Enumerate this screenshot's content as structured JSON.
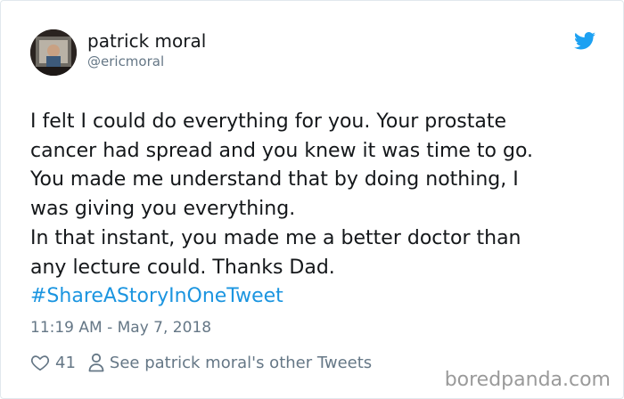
{
  "author": {
    "display_name": "patrick moral",
    "handle": "@ericmoral"
  },
  "tweet": {
    "lines": [
      "I felt I could do everything for you. Your prostate",
      "cancer had spread and you knew it was time to go.",
      "You made me understand that by doing nothing, I",
      "was giving you everything.",
      "In that instant, you made me a better doctor than",
      "any lecture could. Thanks Dad."
    ],
    "hashtag": "#ShareAStoryInOneTweet",
    "timestamp": "11:19 AM - May 7, 2018"
  },
  "actions": {
    "like_count": "41",
    "other_tweets_label": "See patrick moral's other Tweets"
  },
  "watermark": "boredpanda.com",
  "icons": {
    "logo": "twitter-bird-icon",
    "like": "heart-icon",
    "profile": "person-icon"
  },
  "colors": {
    "text": "#14171a",
    "muted": "#657786",
    "hashtag": "#1b95e0",
    "twitter_blue": "#1da1f2",
    "watermark": "#9a9a9a"
  }
}
